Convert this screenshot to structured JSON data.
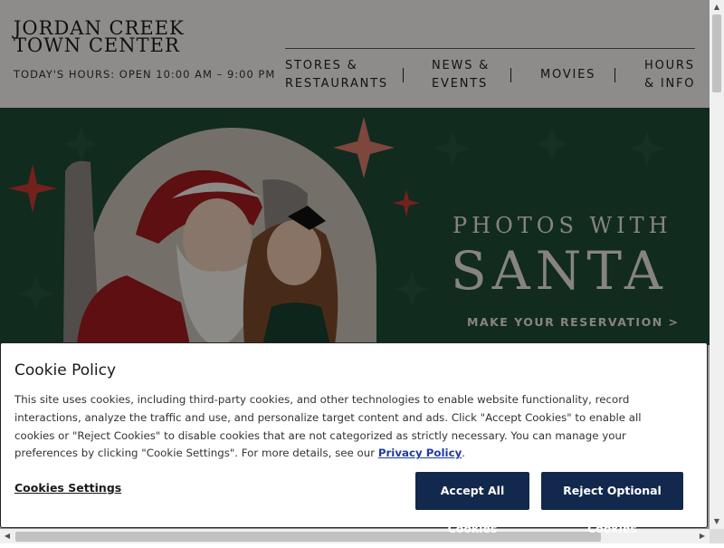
{
  "header": {
    "logo_line1": "JORDAN CREEK",
    "logo_line2": "TOWN CENTER",
    "hours": "TODAY'S HOURS: OPEN 10:00 AM – 9:00 PM",
    "nav": [
      {
        "line1": "STORES &",
        "line2": "RESTAURANTS"
      },
      {
        "line1": "NEWS &",
        "line2": "EVENTS"
      },
      {
        "line1": "MOVIES",
        "line2": ""
      },
      {
        "line1": "HOURS",
        "line2": "& INFO"
      }
    ]
  },
  "hero": {
    "title_small": "PHOTOS WITH",
    "title_big": "SANTA",
    "cta": "MAKE YOUR RESERVATION >",
    "bg_color": "#1e4a35"
  },
  "cookie": {
    "title": "Cookie Policy",
    "body": "This site uses cookies, including third-party cookies, and other technologies to enable website functionality, record interactions, analyze the traffic and use, and personalize target content and ads. Click \"Accept Cookies\" to enable all cookies or \"Reject Cookies\" to disable cookies that are not categorized as strictly necessary. You can manage your preferences by clicking \"Cookie Settings\". For more details, see our ",
    "privacy_link": "Privacy Policy",
    "body_end": ".",
    "settings_label": "Cookies Settings",
    "accept_label": "Accept All Cookies",
    "reject_label": "Reject Optional Cookies",
    "button_color": "#12284c"
  }
}
